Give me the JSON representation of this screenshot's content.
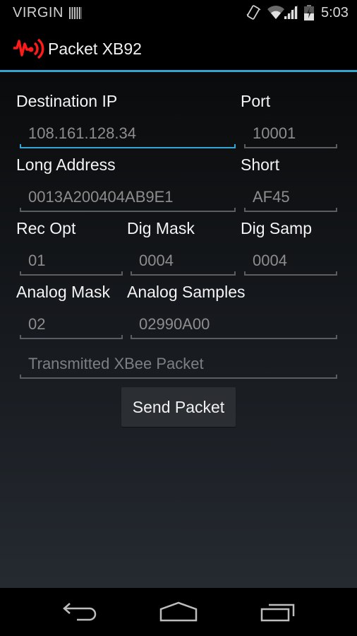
{
  "status_bar": {
    "carrier": "VIRGIN",
    "time": "5:03",
    "icons": [
      "sim-card-icon",
      "vibrate-icon",
      "wifi-icon",
      "signal-icon",
      "battery-charging-icon"
    ]
  },
  "action_bar": {
    "app_icon": "pulse-signal-icon",
    "title": "Packet XB92",
    "accent_color": "#33a6d6"
  },
  "form": {
    "destination_ip": {
      "label": "Destination IP",
      "value": "108.161.128.34"
    },
    "port": {
      "label": "Port",
      "value": "10001"
    },
    "long_address": {
      "label": "Long Address",
      "value": "0013A200404AB9E1"
    },
    "short": {
      "label": "Short",
      "value": "AF45"
    },
    "rec_opt": {
      "label": "Rec Opt",
      "value": "01"
    },
    "dig_mask": {
      "label": "Dig Mask",
      "value": "0004"
    },
    "dig_samp": {
      "label": "Dig Samp",
      "value": "0004"
    },
    "analog_mask": {
      "label": "Analog Mask",
      "value": "02"
    },
    "analog_samples": {
      "label": "Analog Samples",
      "value": "02990A00"
    },
    "transmitted_packet": {
      "placeholder": "Transmitted XBee Packet",
      "value": ""
    },
    "send_button": "Send Packet"
  },
  "nav_bar": {
    "buttons": [
      "back-icon",
      "home-icon",
      "recent-apps-icon"
    ]
  }
}
